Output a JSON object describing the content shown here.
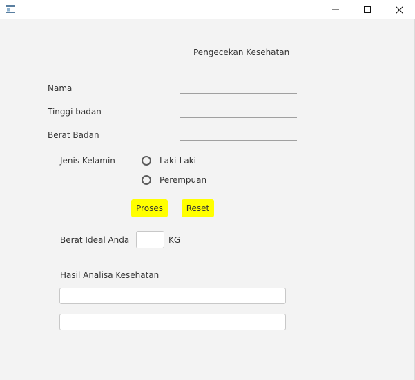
{
  "window": {
    "title": ""
  },
  "form": {
    "header": "Pengecekan Kesehatan",
    "nama_label": "Nama",
    "nama_value": "",
    "tinggi_label": "Tinggi badan",
    "tinggi_value": "",
    "berat_label": "Berat Badan",
    "berat_value": "",
    "gender_label": "Jenis Kelamin",
    "gender_options": [
      "Laki-Laki",
      "Perempuan"
    ],
    "proses_label": "Proses",
    "reset_label": "Reset",
    "ideal_label": "Berat Ideal Anda",
    "ideal_value": "",
    "ideal_unit": "KG",
    "hasil_label": "Hasil Analisa Kesehatan",
    "hasil_value_1": "",
    "hasil_value_2": ""
  },
  "colors": {
    "button_bg": "#ffff00",
    "window_bg": "#f3f3f3"
  },
  "icons": {
    "app": "java-app-icon",
    "minimize": "minimize-icon",
    "maximize": "maximize-icon",
    "close": "close-icon"
  }
}
